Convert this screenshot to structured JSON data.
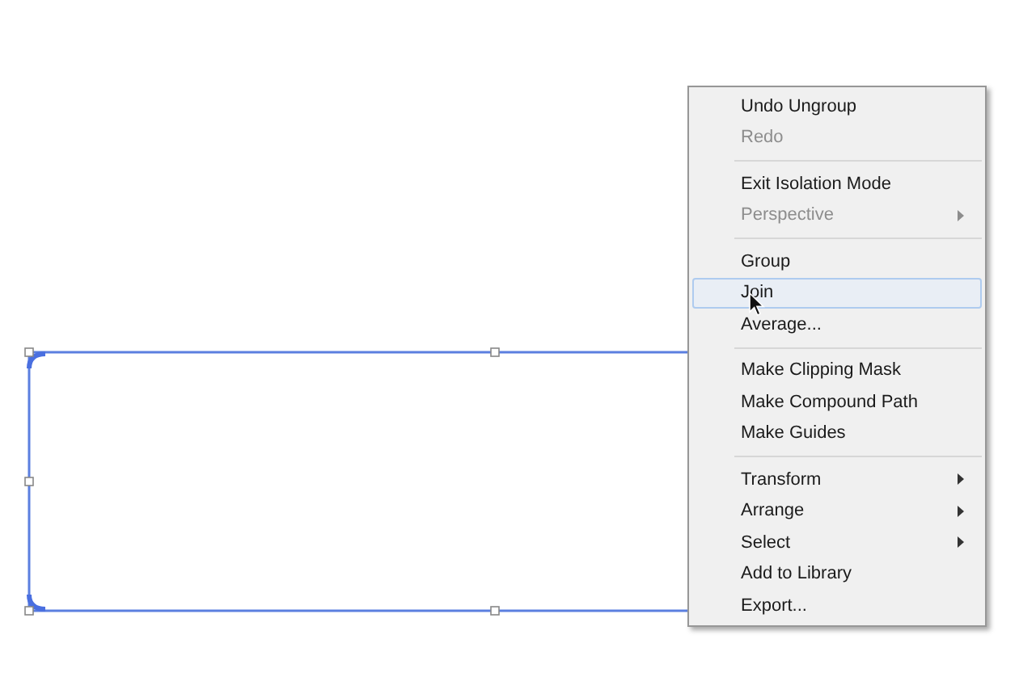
{
  "context_menu": {
    "groups": [
      [
        {
          "label": "Undo Ungroup",
          "disabled": false,
          "submenu": false,
          "selected": false
        },
        {
          "label": "Redo",
          "disabled": true,
          "submenu": false,
          "selected": false
        }
      ],
      [
        {
          "label": "Exit Isolation Mode",
          "disabled": false,
          "submenu": false,
          "selected": false
        },
        {
          "label": "Perspective",
          "disabled": true,
          "submenu": true,
          "selected": false
        }
      ],
      [
        {
          "label": "Group",
          "disabled": false,
          "submenu": false,
          "selected": false
        },
        {
          "label": "Join",
          "disabled": false,
          "submenu": false,
          "selected": true
        },
        {
          "label": "Average...",
          "disabled": false,
          "submenu": false,
          "selected": false
        }
      ],
      [
        {
          "label": "Make Clipping Mask",
          "disabled": false,
          "submenu": false,
          "selected": false
        },
        {
          "label": "Make Compound Path",
          "disabled": false,
          "submenu": false,
          "selected": false
        },
        {
          "label": "Make Guides",
          "disabled": false,
          "submenu": false,
          "selected": false
        }
      ],
      [
        {
          "label": "Transform",
          "disabled": false,
          "submenu": true,
          "selected": false
        },
        {
          "label": "Arrange",
          "disabled": false,
          "submenu": true,
          "selected": false
        },
        {
          "label": "Select",
          "disabled": false,
          "submenu": true,
          "selected": false
        },
        {
          "label": "Add to Library",
          "disabled": false,
          "submenu": false,
          "selected": false
        },
        {
          "label": "Export...",
          "disabled": false,
          "submenu": false,
          "selected": false
        }
      ]
    ]
  }
}
